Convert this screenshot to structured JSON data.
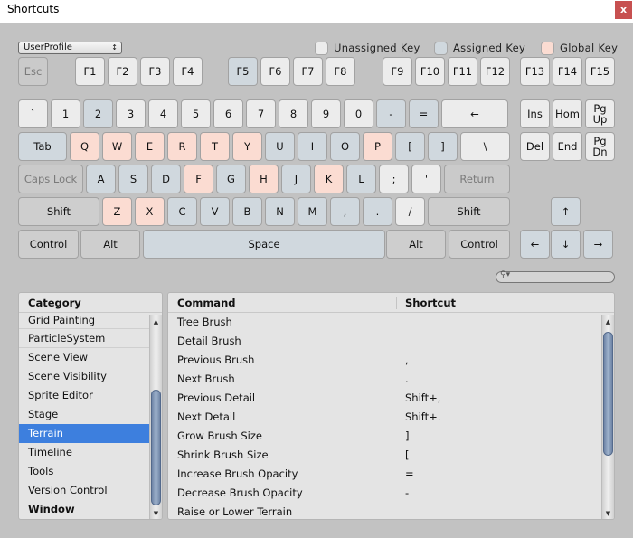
{
  "window": {
    "title": "Shortcuts",
    "close_label": "x",
    "close_color": "#c75050"
  },
  "profile": {
    "selected": "UserProfile",
    "arrow": "↕"
  },
  "legend": [
    {
      "label": "Unassigned Key",
      "color": "#ececec"
    },
    {
      "label": "Assigned Key",
      "color": "#d0d8de"
    },
    {
      "label": "Global Key",
      "color": "#fbdcd2"
    }
  ],
  "keys": {
    "function_row": [
      {
        "label": "Esc",
        "state": "disabled"
      },
      {
        "label": "F1",
        "state": "unassigned"
      },
      {
        "label": "F2",
        "state": "unassigned"
      },
      {
        "label": "F3",
        "state": "unassigned"
      },
      {
        "label": "F4",
        "state": "unassigned"
      },
      {
        "label": "F5",
        "state": "assigned"
      },
      {
        "label": "F6",
        "state": "unassigned"
      },
      {
        "label": "F7",
        "state": "unassigned"
      },
      {
        "label": "F8",
        "state": "unassigned"
      },
      {
        "label": "F9",
        "state": "unassigned"
      },
      {
        "label": "F10",
        "state": "unassigned"
      },
      {
        "label": "F11",
        "state": "unassigned"
      },
      {
        "label": "F12",
        "state": "unassigned"
      },
      {
        "label": "F13",
        "state": "unassigned"
      },
      {
        "label": "F14",
        "state": "unassigned"
      },
      {
        "label": "F15",
        "state": "unassigned"
      }
    ],
    "number_row": [
      {
        "label": "`",
        "state": "unassigned"
      },
      {
        "label": "1",
        "state": "unassigned"
      },
      {
        "label": "2",
        "state": "assigned"
      },
      {
        "label": "3",
        "state": "unassigned"
      },
      {
        "label": "4",
        "state": "unassigned"
      },
      {
        "label": "5",
        "state": "unassigned"
      },
      {
        "label": "6",
        "state": "unassigned"
      },
      {
        "label": "7",
        "state": "unassigned"
      },
      {
        "label": "8",
        "state": "unassigned"
      },
      {
        "label": "9",
        "state": "unassigned"
      },
      {
        "label": "0",
        "state": "unassigned"
      },
      {
        "label": "-",
        "state": "assigned"
      },
      {
        "label": "=",
        "state": "assigned"
      },
      {
        "label": "←",
        "state": "unassigned"
      }
    ],
    "tab_row": [
      {
        "label": "Tab",
        "state": "assigned"
      },
      {
        "label": "Q",
        "state": "global"
      },
      {
        "label": "W",
        "state": "global"
      },
      {
        "label": "E",
        "state": "global"
      },
      {
        "label": "R",
        "state": "global"
      },
      {
        "label": "T",
        "state": "global"
      },
      {
        "label": "Y",
        "state": "global"
      },
      {
        "label": "U",
        "state": "assigned"
      },
      {
        "label": "I",
        "state": "assigned"
      },
      {
        "label": "O",
        "state": "assigned"
      },
      {
        "label": "P",
        "state": "global"
      },
      {
        "label": "[",
        "state": "assigned"
      },
      {
        "label": "]",
        "state": "assigned"
      },
      {
        "label": "\\",
        "state": "unassigned"
      }
    ],
    "caps_row": [
      {
        "label": "Caps Lock",
        "state": "disabled"
      },
      {
        "label": "A",
        "state": "assigned"
      },
      {
        "label": "S",
        "state": "assigned"
      },
      {
        "label": "D",
        "state": "assigned"
      },
      {
        "label": "F",
        "state": "global"
      },
      {
        "label": "G",
        "state": "assigned"
      },
      {
        "label": "H",
        "state": "global"
      },
      {
        "label": "J",
        "state": "assigned"
      },
      {
        "label": "K",
        "state": "global"
      },
      {
        "label": "L",
        "state": "assigned"
      },
      {
        "label": ";",
        "state": "unassigned"
      },
      {
        "label": "'",
        "state": "unassigned"
      },
      {
        "label": "Return",
        "state": "disabled"
      }
    ],
    "shift_row": [
      {
        "label": "Shift",
        "state": "modifier"
      },
      {
        "label": "Z",
        "state": "global"
      },
      {
        "label": "X",
        "state": "global"
      },
      {
        "label": "C",
        "state": "assigned"
      },
      {
        "label": "V",
        "state": "assigned"
      },
      {
        "label": "B",
        "state": "assigned"
      },
      {
        "label": "N",
        "state": "assigned"
      },
      {
        "label": "M",
        "state": "assigned"
      },
      {
        "label": ",",
        "state": "assigned"
      },
      {
        "label": ".",
        "state": "assigned"
      },
      {
        "label": "/",
        "state": "unassigned"
      },
      {
        "label": "Shift",
        "state": "modifier"
      }
    ],
    "bottom_row": [
      {
        "label": "Control",
        "state": "modifier"
      },
      {
        "label": "Alt",
        "state": "modifier"
      },
      {
        "label": "Space",
        "state": "assigned"
      },
      {
        "label": "Alt",
        "state": "modifier"
      },
      {
        "label": "Control",
        "state": "modifier"
      }
    ],
    "nav": [
      {
        "label": "Ins",
        "state": "unassigned"
      },
      {
        "label": "Hom",
        "state": "unassigned"
      },
      {
        "label": "Pg Up",
        "state": "unassigned"
      },
      {
        "label": "Del",
        "state": "unassigned"
      },
      {
        "label": "End",
        "state": "unassigned"
      },
      {
        "label": "Pg Dn",
        "state": "unassigned"
      }
    ],
    "arrows": [
      {
        "label": "↑",
        "state": "assigned"
      },
      {
        "label": "←",
        "state": "assigned"
      },
      {
        "label": "↓",
        "state": "assigned"
      },
      {
        "label": "→",
        "state": "assigned"
      }
    ]
  },
  "search": {
    "icon": "search-icon",
    "value": ""
  },
  "category": {
    "header": "Category",
    "items": [
      {
        "label": "Grid Painting"
      },
      {
        "label": "ParticleSystem"
      },
      {
        "label": "Scene View"
      },
      {
        "label": "Scene Visibility"
      },
      {
        "label": "Sprite Editor"
      },
      {
        "label": "Stage"
      },
      {
        "label": "Terrain",
        "selected": true
      },
      {
        "label": "Timeline"
      },
      {
        "label": "Tools"
      },
      {
        "label": "Version Control"
      },
      {
        "label": "Window",
        "bold": true
      }
    ]
  },
  "commands": {
    "header_command": "Command",
    "header_shortcut": "Shortcut",
    "rows": [
      {
        "command": "Tree Brush",
        "shortcut": ""
      },
      {
        "command": "Detail Brush",
        "shortcut": ""
      },
      {
        "command": "Previous Brush",
        "shortcut": ","
      },
      {
        "command": "Next Brush",
        "shortcut": "."
      },
      {
        "command": "Previous Detail",
        "shortcut": "Shift+,"
      },
      {
        "command": "Next Detail",
        "shortcut": "Shift+."
      },
      {
        "command": "Grow Brush Size",
        "shortcut": "]"
      },
      {
        "command": "Shrink Brush Size",
        "shortcut": "["
      },
      {
        "command": "Increase Brush Opacity",
        "shortcut": "="
      },
      {
        "command": "Decrease Brush Opacity",
        "shortcut": "-"
      },
      {
        "command": "Raise or Lower Terrain",
        "shortcut": ""
      }
    ]
  }
}
